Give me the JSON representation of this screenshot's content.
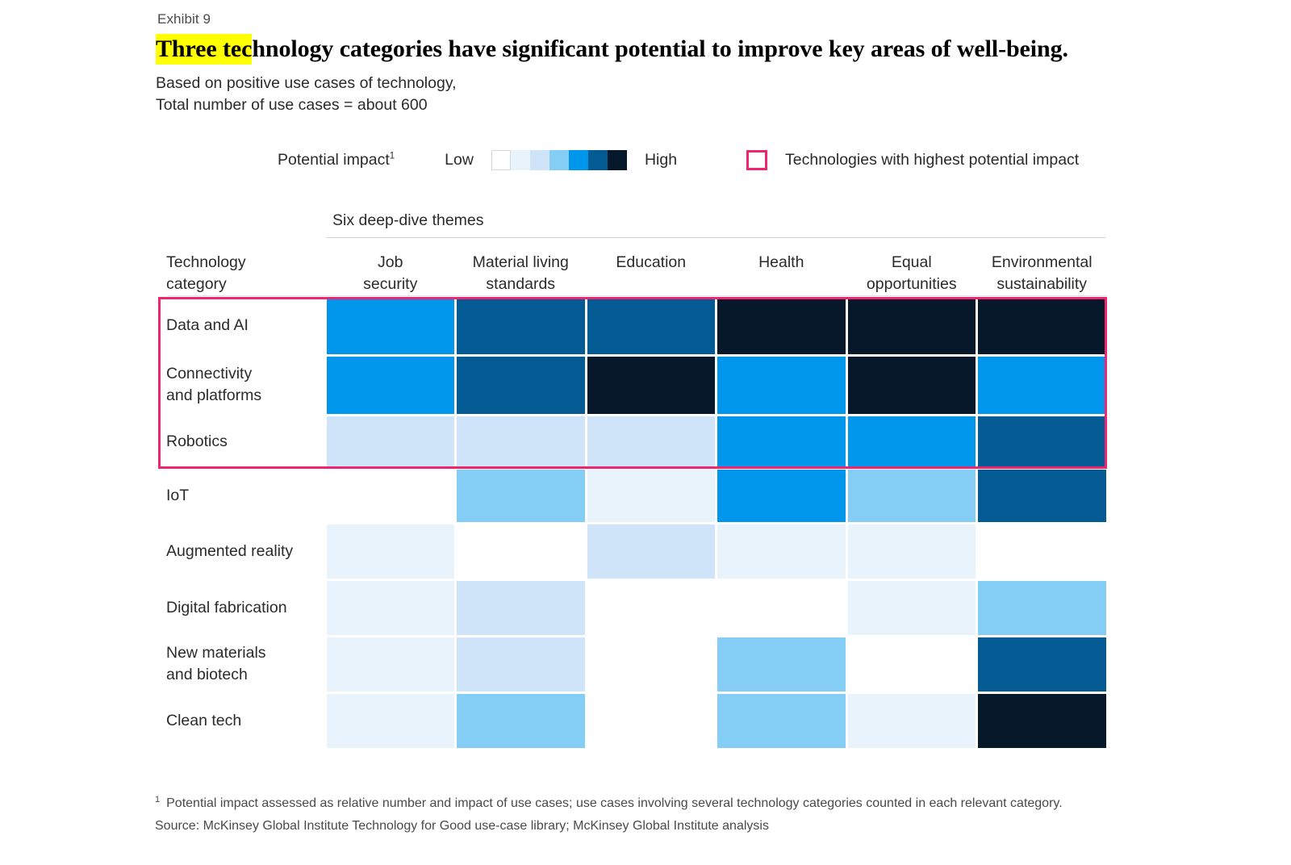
{
  "exhibit": {
    "label": "Exhibit 9",
    "headline_highlight": "Three tec",
    "headline_rest": "hnology categories have significant potential to improve key areas of well-being.",
    "subtitle_line1": "Based on positive use cases of technology,",
    "subtitle_line2": "Total number of use cases = about 600"
  },
  "legend": {
    "impact_label": "Potential impact",
    "impact_footnote_marker": "1",
    "low_label": "Low",
    "high_label": "High",
    "highlight_box_label": "Technologies with highest potential impact",
    "highlight_color": "#f0256f",
    "scale_colors": [
      "#ffffff",
      "#e8f3fc",
      "#cfe3f9",
      "#84cdf5",
      "#0096eb",
      "#045a93",
      "#07182b"
    ]
  },
  "matrix": {
    "themes_band_label": "Six deep-dive themes",
    "row_header_line1": "Technology",
    "row_header_line2": "category",
    "columns": [
      "Job security",
      "Material living standards",
      "Education",
      "Health",
      "Equal opportunities",
      "Environmental sustainability"
    ],
    "column_lines": [
      [
        "Job",
        "security"
      ],
      [
        "Material living",
        "standards"
      ],
      [
        "Education"
      ],
      [
        "Health"
      ],
      [
        "Equal",
        "opportunities"
      ],
      [
        "Environmental",
        "sustainability"
      ]
    ],
    "rows": [
      {
        "label_lines": [
          "Data and AI"
        ],
        "highlighted": true
      },
      {
        "label_lines": [
          "Connectivity",
          "and platforms"
        ],
        "highlighted": true
      },
      {
        "label_lines": [
          "Robotics"
        ],
        "highlighted": true
      },
      {
        "label_lines": [
          "IoT"
        ],
        "highlighted": false
      },
      {
        "label_lines": [
          "Augmented reality"
        ],
        "highlighted": false
      },
      {
        "label_lines": [
          "Digital fabrication"
        ],
        "highlighted": false
      },
      {
        "label_lines": [
          "New materials",
          "and biotech"
        ],
        "highlighted": false
      },
      {
        "label_lines": [
          "Clean tech"
        ],
        "highlighted": false
      }
    ]
  },
  "chart_data": {
    "type": "heatmap",
    "title": "Three technology categories have significant potential to improve key areas of well-being.",
    "subtitle": "Based on positive use cases of technology, Total number of use cases = about 600",
    "xlabel": "Six deep-dive themes",
    "ylabel": "Technology category",
    "legend_position": "top",
    "grid": false,
    "scale_min_label": "Low",
    "scale_max_label": "High",
    "scale_levels": [
      0,
      1,
      2,
      3,
      4,
      5,
      6
    ],
    "scale_colors": [
      "#ffffff",
      "#e8f3fc",
      "#cfe3f9",
      "#84cdf5",
      "#0096eb",
      "#045a93",
      "#07182b"
    ],
    "categories": [
      "Job security",
      "Material living standards",
      "Education",
      "Health",
      "Equal opportunities",
      "Environmental sustainability"
    ],
    "rows": [
      "Data and AI",
      "Connectivity and platforms",
      "Robotics",
      "IoT",
      "Augmented reality",
      "Digital fabrication",
      "New materials and biotech",
      "Clean tech"
    ],
    "values": [
      [
        4,
        5,
        5,
        6,
        6,
        6
      ],
      [
        4,
        5,
        6,
        4,
        6,
        4
      ],
      [
        2,
        2,
        2,
        4,
        4,
        5
      ],
      [
        0,
        3,
        1,
        4,
        3,
        5
      ],
      [
        1,
        0,
        2,
        1,
        1,
        0
      ],
      [
        1,
        2,
        0,
        0,
        1,
        3
      ],
      [
        1,
        2,
        0,
        3,
        0,
        5
      ],
      [
        1,
        3,
        0,
        3,
        1,
        6
      ]
    ],
    "highlighted_rows": [
      "Data and AI",
      "Connectivity and platforms",
      "Robotics"
    ],
    "highlight_color": "#f0256f"
  },
  "footnotes": {
    "marker": "1",
    "note": "Potential impact assessed as relative number and impact of use cases; use cases involving several technology categories counted in each relevant category.",
    "source": "Source: McKinsey Global Institute Technology for Good use-case library; McKinsey Global Institute analysis"
  }
}
